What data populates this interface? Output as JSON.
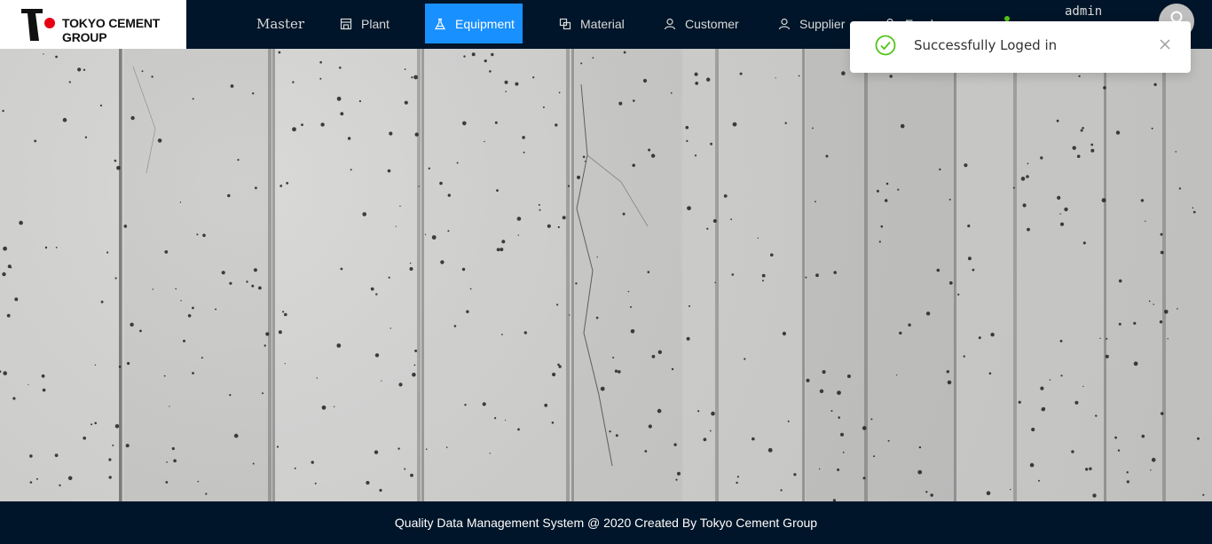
{
  "brand": {
    "name": "TOKYO CEMENT GROUP"
  },
  "nav": {
    "items": [
      {
        "label": "Master",
        "icon": "none"
      },
      {
        "label": "Plant",
        "icon": "shop-icon"
      },
      {
        "label": "Equipment",
        "icon": "flask-icon",
        "active": true
      },
      {
        "label": "Material",
        "icon": "block-icon"
      },
      {
        "label": "Customer",
        "icon": "user-icon"
      },
      {
        "label": "Supplier",
        "icon": "user-icon"
      },
      {
        "label": "Employee",
        "icon": "user-icon"
      }
    ]
  },
  "user": {
    "name": "admin",
    "status_color": "#52c41a"
  },
  "toast": {
    "message": "Successfully Loged in",
    "type": "success"
  },
  "footer": {
    "text": "Quality Data Management System @ 2020 Created By Tokyo Cement Group"
  },
  "colors": {
    "header_bg": "#001529",
    "active_tab": "#1890ff",
    "success": "#52c41a"
  }
}
